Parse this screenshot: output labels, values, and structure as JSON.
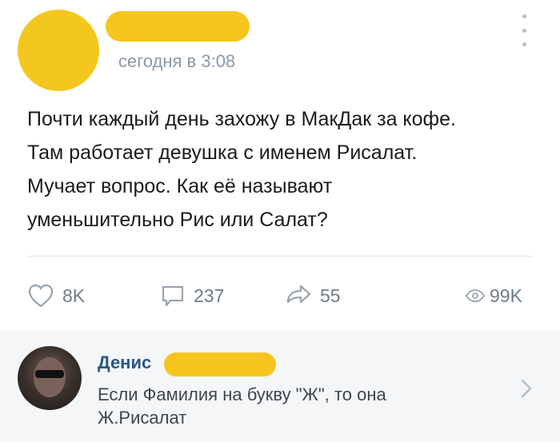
{
  "post": {
    "timestamp": "сегодня в 3:08",
    "text": "Почти каждый день захожу в МакДак за кофе.\nТам работает девушка с именем Рисалат.\nМучает вопрос. Как её называют\nуменьшительно Рис или Салат?",
    "actions": {
      "likes": "8K",
      "comments": "237",
      "reposts": "55",
      "views": "99K"
    }
  },
  "comment": {
    "author": "Денис",
    "text": "Если Фамилия на букву \"Ж\", то она\nЖ.Рисалат"
  },
  "colors": {
    "redaction": "#f6c61f",
    "link": "#2a5885",
    "muted": "#8b98a6"
  }
}
